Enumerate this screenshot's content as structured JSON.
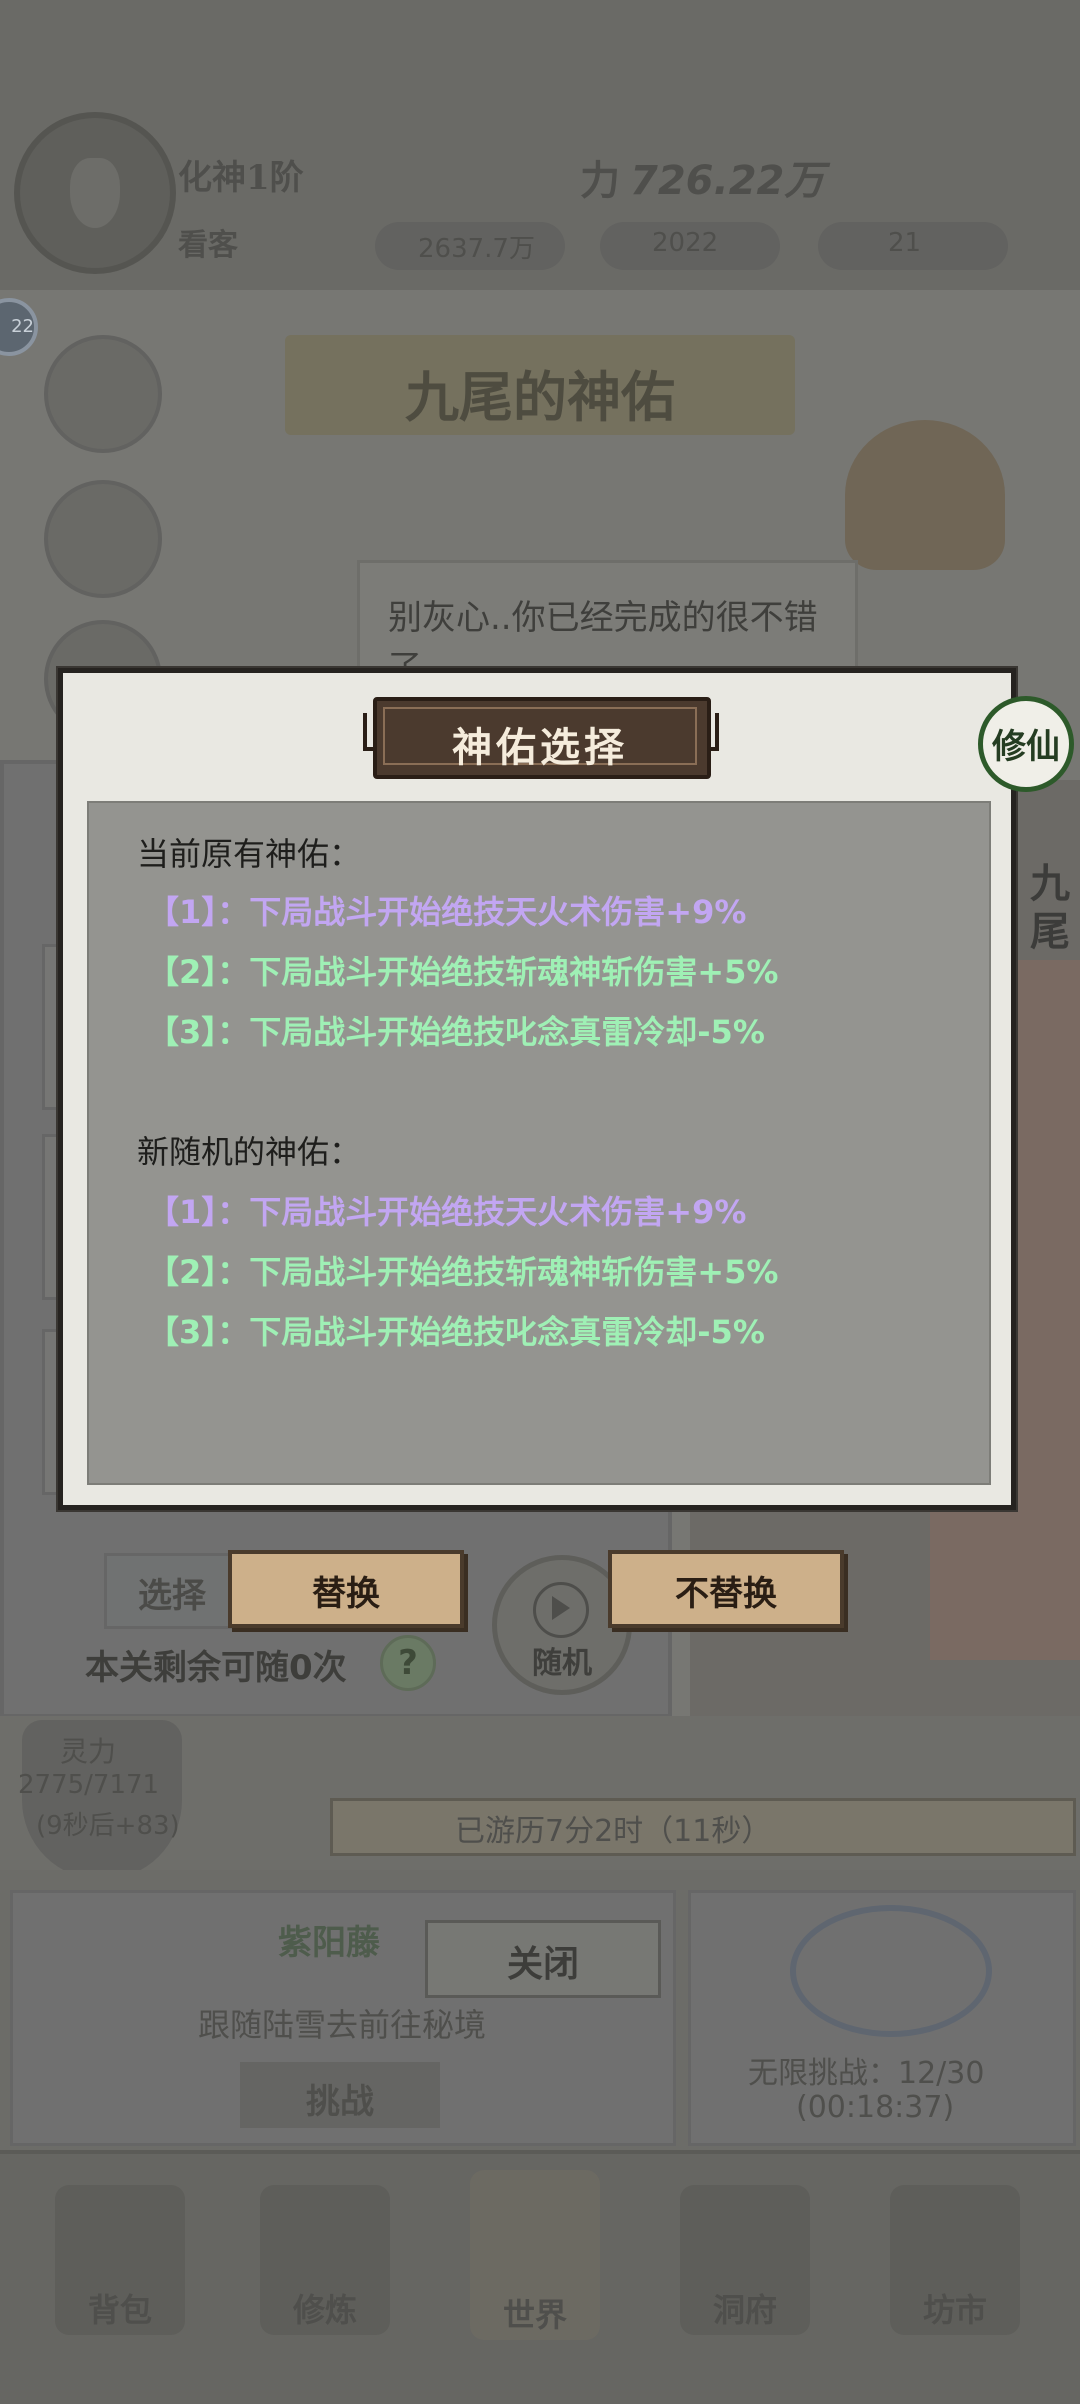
{
  "background": {
    "player_realm": "化神1阶",
    "player_title": "看客",
    "power_label": "力",
    "power_value": "726.22万",
    "stat1": "2637.7万",
    "stat2": "2022",
    "stat3": "21",
    "level_badge": "22",
    "banner_title": "九尾的神佑",
    "speech_text": "别灰心..你已经完成的很不错了",
    "side_name": "九尾",
    "choose_label": "选择",
    "remaining_text": "本关剩余可随0次",
    "help_symbol": "?",
    "random_label": "随机",
    "spirit_label": "灵力",
    "spirit_value": "2775/7171",
    "spirit_sub": "(9秒后+83)",
    "progress_text": "已游历7分2时（11秒）",
    "event_title": "紫阳藤",
    "event_desc": "跟随陆雪去前往秘境",
    "close_label": "关闭",
    "challenge_label": "挑战",
    "limit_text": "无限挑战：12/30",
    "limit_timer": "(00:18:37)",
    "nav": [
      "背包",
      "修炼",
      "世界",
      "洞府",
      "坊市"
    ]
  },
  "modal": {
    "title": "神佑选择",
    "current_label": "当前原有神佑：",
    "current_buffs": [
      "【1】：下局战斗开始绝技天火术伤害+9%",
      "【2】：下局战斗开始绝技斩魂神斩伤害+5%",
      "【3】：下局战斗开始绝技叱念真雷冷却-5%"
    ],
    "new_label": "新随机的神佑：",
    "new_buffs": [
      "【1】：下局战斗开始绝技天火术伤害+9%",
      "【2】：下局战斗开始绝技斩魂神斩伤害+5%",
      "【3】：下局战斗开始绝技叱念真雷冷却-5%"
    ],
    "buff_colors": [
      "purple",
      "green",
      "green"
    ]
  },
  "actions": {
    "replace_label": "替换",
    "keep_label": "不替换"
  },
  "badge": {
    "text": "修仙"
  }
}
